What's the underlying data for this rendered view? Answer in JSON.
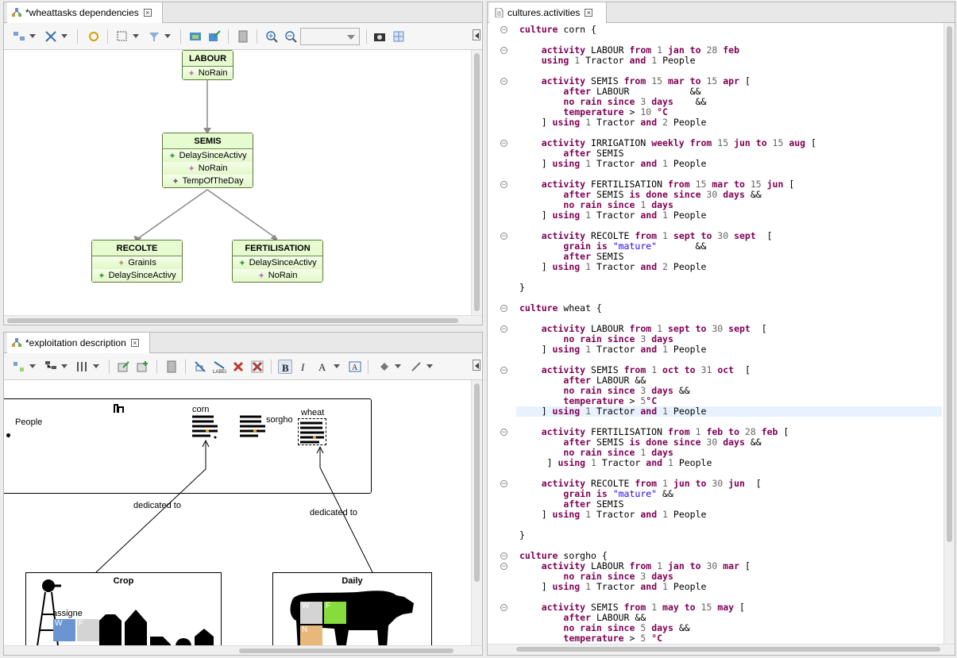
{
  "left_top": {
    "tab_title": "*wheattasks dependencies",
    "nodes": [
      {
        "title": "LABOUR",
        "rows": [
          {
            "icon": "pink-star-icon",
            "label": "NoRain"
          }
        ]
      },
      {
        "title": "SEMIS",
        "rows": [
          {
            "icon": "green-star-icon",
            "label": "DelaySinceActivy"
          },
          {
            "icon": "pink-star-icon",
            "label": "NoRain"
          },
          {
            "icon": "gray-star-icon",
            "label": "TempOfTheDay"
          }
        ]
      },
      {
        "title": "RECOLTE",
        "rows": [
          {
            "icon": "tan-star-icon",
            "label": "GrainIs"
          },
          {
            "icon": "green-star-icon",
            "label": "DelaySinceActivy"
          }
        ]
      },
      {
        "title": "FERTILISATION",
        "rows": [
          {
            "icon": "green-star-icon",
            "label": "DelaySinceActivy"
          },
          {
            "icon": "pink-star-icon",
            "label": "NoRain"
          }
        ]
      }
    ]
  },
  "left_bottom": {
    "tab_title": "*exploitation description",
    "labels": {
      "people": "People",
      "corn": "corn",
      "sorgho": "sorgho",
      "wheat": "wheat",
      "dedicated1": "dedicated to",
      "dedicated2": "dedicated to",
      "crop": "Crop",
      "daily": "Daily",
      "assigned": "assigne",
      "w1": "W",
      "f1": "F",
      "w2": "W",
      "f2": "F",
      "n2": "N"
    }
  },
  "right": {
    "tab_title": "cultures.activities",
    "highlight_line": 37,
    "lines": [
      [
        {
          "t": "culture ",
          "c": "kw"
        },
        {
          "t": "corn {",
          "c": "nm"
        }
      ],
      [],
      [
        {
          "t": "    "
        },
        {
          "t": "activity ",
          "c": "kw"
        },
        {
          "t": "LABOUR ",
          "c": "nm"
        },
        {
          "t": "from ",
          "c": "kw"
        },
        {
          "t": "1 ",
          "c": "num"
        },
        {
          "t": "jan ",
          "c": "kw"
        },
        {
          "t": "to ",
          "c": "kw"
        },
        {
          "t": "28 ",
          "c": "num"
        },
        {
          "t": "feb",
          "c": "kw"
        }
      ],
      [
        {
          "t": "    "
        },
        {
          "t": "using ",
          "c": "kw"
        },
        {
          "t": "1 ",
          "c": "num"
        },
        {
          "t": "Tractor ",
          "c": "nm"
        },
        {
          "t": "and ",
          "c": "kw"
        },
        {
          "t": "1 ",
          "c": "num"
        },
        {
          "t": "People",
          "c": "nm"
        }
      ],
      [],
      [
        {
          "t": "    "
        },
        {
          "t": "activity ",
          "c": "kw"
        },
        {
          "t": "SEMIS ",
          "c": "nm"
        },
        {
          "t": "from ",
          "c": "kw"
        },
        {
          "t": "15 ",
          "c": "num"
        },
        {
          "t": "mar ",
          "c": "kw"
        },
        {
          "t": "to ",
          "c": "kw"
        },
        {
          "t": "15 ",
          "c": "num"
        },
        {
          "t": "apr ",
          "c": "kw"
        },
        {
          "t": "[",
          "c": "nm"
        }
      ],
      [
        {
          "t": "        "
        },
        {
          "t": "after ",
          "c": "kw"
        },
        {
          "t": "LABOUR           &&",
          "c": "nm"
        }
      ],
      [
        {
          "t": "        "
        },
        {
          "t": "no rain since ",
          "c": "kw"
        },
        {
          "t": "3 ",
          "c": "num"
        },
        {
          "t": "days",
          "c": "kw"
        },
        {
          "t": "    &&",
          "c": "nm"
        }
      ],
      [
        {
          "t": "        "
        },
        {
          "t": "temperature ",
          "c": "kw"
        },
        {
          "t": "> ",
          "c": "nm"
        },
        {
          "t": "10 ",
          "c": "num"
        },
        {
          "t": "°C",
          "c": "kw"
        }
      ],
      [
        {
          "t": "    ] "
        },
        {
          "t": "using ",
          "c": "kw"
        },
        {
          "t": "1 ",
          "c": "num"
        },
        {
          "t": "Tractor ",
          "c": "nm"
        },
        {
          "t": "and ",
          "c": "kw"
        },
        {
          "t": "2 ",
          "c": "num"
        },
        {
          "t": "People",
          "c": "nm"
        }
      ],
      [],
      [
        {
          "t": "    "
        },
        {
          "t": "activity ",
          "c": "kw"
        },
        {
          "t": "IRRIGATION ",
          "c": "nm"
        },
        {
          "t": "weekly ",
          "c": "kw"
        },
        {
          "t": "from ",
          "c": "kw"
        },
        {
          "t": "15 ",
          "c": "num"
        },
        {
          "t": "jun ",
          "c": "kw"
        },
        {
          "t": "to ",
          "c": "kw"
        },
        {
          "t": "15 ",
          "c": "num"
        },
        {
          "t": "aug ",
          "c": "kw"
        },
        {
          "t": "[",
          "c": "nm"
        }
      ],
      [
        {
          "t": "        "
        },
        {
          "t": "after ",
          "c": "kw"
        },
        {
          "t": "SEMIS",
          "c": "nm"
        }
      ],
      [
        {
          "t": "    ] "
        },
        {
          "t": "using ",
          "c": "kw"
        },
        {
          "t": "1 ",
          "c": "num"
        },
        {
          "t": "Tractor ",
          "c": "nm"
        },
        {
          "t": "and ",
          "c": "kw"
        },
        {
          "t": "1 ",
          "c": "num"
        },
        {
          "t": "People",
          "c": "nm"
        }
      ],
      [],
      [
        {
          "t": "    "
        },
        {
          "t": "activity ",
          "c": "kw"
        },
        {
          "t": "FERTILISATION ",
          "c": "nm"
        },
        {
          "t": "from ",
          "c": "kw"
        },
        {
          "t": "15 ",
          "c": "num"
        },
        {
          "t": "mar ",
          "c": "kw"
        },
        {
          "t": "to ",
          "c": "kw"
        },
        {
          "t": "15 ",
          "c": "num"
        },
        {
          "t": "jun ",
          "c": "kw"
        },
        {
          "t": "[",
          "c": "nm"
        }
      ],
      [
        {
          "t": "        "
        },
        {
          "t": "after ",
          "c": "kw"
        },
        {
          "t": "SEMIS ",
          "c": "nm"
        },
        {
          "t": "is done since ",
          "c": "kw"
        },
        {
          "t": "30 ",
          "c": "num"
        },
        {
          "t": "days ",
          "c": "kw"
        },
        {
          "t": "&&",
          "c": "nm"
        }
      ],
      [
        {
          "t": "        "
        },
        {
          "t": "no rain since ",
          "c": "kw"
        },
        {
          "t": "1 ",
          "c": "num"
        },
        {
          "t": "days",
          "c": "kw"
        }
      ],
      [
        {
          "t": "    ] "
        },
        {
          "t": "using ",
          "c": "kw"
        },
        {
          "t": "1 ",
          "c": "num"
        },
        {
          "t": "Tractor ",
          "c": "nm"
        },
        {
          "t": "and ",
          "c": "kw"
        },
        {
          "t": "1 ",
          "c": "num"
        },
        {
          "t": "People",
          "c": "nm"
        }
      ],
      [],
      [
        {
          "t": "    "
        },
        {
          "t": "activity ",
          "c": "kw"
        },
        {
          "t": "RECOLTE ",
          "c": "nm"
        },
        {
          "t": "from ",
          "c": "kw"
        },
        {
          "t": "1 ",
          "c": "num"
        },
        {
          "t": "sept ",
          "c": "kw"
        },
        {
          "t": "to ",
          "c": "kw"
        },
        {
          "t": "30 ",
          "c": "num"
        },
        {
          "t": "sept  ",
          "c": "kw"
        },
        {
          "t": "[",
          "c": "nm"
        }
      ],
      [
        {
          "t": "        "
        },
        {
          "t": "grain is ",
          "c": "kw"
        },
        {
          "t": "\"mature\"",
          "c": "str"
        },
        {
          "t": "       &&",
          "c": "nm"
        }
      ],
      [
        {
          "t": "        "
        },
        {
          "t": "after ",
          "c": "kw"
        },
        {
          "t": "SEMIS",
          "c": "nm"
        }
      ],
      [
        {
          "t": "    ] "
        },
        {
          "t": "using ",
          "c": "kw"
        },
        {
          "t": "1 ",
          "c": "num"
        },
        {
          "t": "Tractor ",
          "c": "nm"
        },
        {
          "t": "and ",
          "c": "kw"
        },
        {
          "t": "2 ",
          "c": "num"
        },
        {
          "t": "People",
          "c": "nm"
        }
      ],
      [],
      [
        {
          "t": "}",
          "c": "nm"
        }
      ],
      [],
      [
        {
          "t": "culture ",
          "c": "kw"
        },
        {
          "t": "wheat {",
          "c": "nm"
        }
      ],
      [],
      [
        {
          "t": "    "
        },
        {
          "t": "activity ",
          "c": "kw"
        },
        {
          "t": "LABOUR ",
          "c": "nm"
        },
        {
          "t": "from ",
          "c": "kw"
        },
        {
          "t": "1 ",
          "c": "num"
        },
        {
          "t": "sept ",
          "c": "kw"
        },
        {
          "t": "to ",
          "c": "kw"
        },
        {
          "t": "30 ",
          "c": "num"
        },
        {
          "t": "sept  ",
          "c": "kw"
        },
        {
          "t": "[",
          "c": "nm"
        }
      ],
      [
        {
          "t": "        "
        },
        {
          "t": "no rain since ",
          "c": "kw"
        },
        {
          "t": "3 ",
          "c": "num"
        },
        {
          "t": "days",
          "c": "kw"
        }
      ],
      [
        {
          "t": "    ] "
        },
        {
          "t": "using ",
          "c": "kw"
        },
        {
          "t": "1 ",
          "c": "num"
        },
        {
          "t": "Tractor ",
          "c": "nm"
        },
        {
          "t": "and ",
          "c": "kw"
        },
        {
          "t": "1 ",
          "c": "num"
        },
        {
          "t": "People",
          "c": "nm"
        }
      ],
      [],
      [
        {
          "t": "    "
        },
        {
          "t": "activity ",
          "c": "kw"
        },
        {
          "t": "SEMIS ",
          "c": "nm"
        },
        {
          "t": "from ",
          "c": "kw"
        },
        {
          "t": "1 ",
          "c": "num"
        },
        {
          "t": "oct ",
          "c": "kw"
        },
        {
          "t": "to ",
          "c": "kw"
        },
        {
          "t": "31 ",
          "c": "num"
        },
        {
          "t": "oct  ",
          "c": "kw"
        },
        {
          "t": "[",
          "c": "nm"
        }
      ],
      [
        {
          "t": "        "
        },
        {
          "t": "after ",
          "c": "kw"
        },
        {
          "t": "LABOUR &&",
          "c": "nm"
        }
      ],
      [
        {
          "t": "        "
        },
        {
          "t": "no rain since ",
          "c": "kw"
        },
        {
          "t": "3 ",
          "c": "num"
        },
        {
          "t": "days ",
          "c": "kw"
        },
        {
          "t": "&&",
          "c": "nm"
        }
      ],
      [
        {
          "t": "        "
        },
        {
          "t": "temperature ",
          "c": "kw"
        },
        {
          "t": "> ",
          "c": "nm"
        },
        {
          "t": "5",
          "c": "num"
        },
        {
          "t": "°C",
          "c": "kw"
        }
      ],
      [
        {
          "t": "    ] "
        },
        {
          "t": "using ",
          "c": "kw"
        },
        {
          "t": "1 ",
          "c": "num"
        },
        {
          "t": "Tractor ",
          "c": "nm"
        },
        {
          "t": "and ",
          "c": "kw"
        },
        {
          "t": "1 ",
          "c": "num"
        },
        {
          "t": "People",
          "c": "nm"
        }
      ],
      [],
      [
        {
          "t": "    "
        },
        {
          "t": "activity ",
          "c": "kw"
        },
        {
          "t": "FERTILISATION ",
          "c": "nm"
        },
        {
          "t": "from ",
          "c": "kw"
        },
        {
          "t": "1 ",
          "c": "num"
        },
        {
          "t": "feb ",
          "c": "kw"
        },
        {
          "t": "to ",
          "c": "kw"
        },
        {
          "t": "28 ",
          "c": "num"
        },
        {
          "t": "feb ",
          "c": "kw"
        },
        {
          "t": "[",
          "c": "nm"
        }
      ],
      [
        {
          "t": "        "
        },
        {
          "t": "after ",
          "c": "kw"
        },
        {
          "t": "SEMIS ",
          "c": "nm"
        },
        {
          "t": "is done since ",
          "c": "kw"
        },
        {
          "t": "30 ",
          "c": "num"
        },
        {
          "t": "days ",
          "c": "kw"
        },
        {
          "t": "&&",
          "c": "nm"
        }
      ],
      [
        {
          "t": "        "
        },
        {
          "t": "no rain since ",
          "c": "kw"
        },
        {
          "t": "1 ",
          "c": "num"
        },
        {
          "t": "days",
          "c": "kw"
        }
      ],
      [
        {
          "t": "     ] "
        },
        {
          "t": "using ",
          "c": "kw"
        },
        {
          "t": "1 ",
          "c": "num"
        },
        {
          "t": "Tractor ",
          "c": "nm"
        },
        {
          "t": "and ",
          "c": "kw"
        },
        {
          "t": "1 ",
          "c": "num"
        },
        {
          "t": "People",
          "c": "nm"
        }
      ],
      [],
      [
        {
          "t": "    "
        },
        {
          "t": "activity ",
          "c": "kw"
        },
        {
          "t": "RECOLTE ",
          "c": "nm"
        },
        {
          "t": "from ",
          "c": "kw"
        },
        {
          "t": "1 ",
          "c": "num"
        },
        {
          "t": "jun ",
          "c": "kw"
        },
        {
          "t": "to ",
          "c": "kw"
        },
        {
          "t": "30 ",
          "c": "num"
        },
        {
          "t": "jun  ",
          "c": "kw"
        },
        {
          "t": "[",
          "c": "nm"
        }
      ],
      [
        {
          "t": "        "
        },
        {
          "t": "grain is ",
          "c": "kw"
        },
        {
          "t": "\"mature\"",
          "c": "str"
        },
        {
          "t": " &&",
          "c": "nm"
        }
      ],
      [
        {
          "t": "        "
        },
        {
          "t": "after ",
          "c": "kw"
        },
        {
          "t": "SEMIS",
          "c": "nm"
        }
      ],
      [
        {
          "t": "    ] "
        },
        {
          "t": "using ",
          "c": "kw"
        },
        {
          "t": "1 ",
          "c": "num"
        },
        {
          "t": "Tractor ",
          "c": "nm"
        },
        {
          "t": "and ",
          "c": "kw"
        },
        {
          "t": "1 ",
          "c": "num"
        },
        {
          "t": "People",
          "c": "nm"
        }
      ],
      [],
      [
        {
          "t": "}",
          "c": "nm"
        }
      ],
      [],
      [
        {
          "t": "culture ",
          "c": "kw"
        },
        {
          "t": "sorgho {",
          "c": "nm"
        }
      ],
      [
        {
          "t": "    "
        },
        {
          "t": "activity ",
          "c": "kw"
        },
        {
          "t": "LABOUR ",
          "c": "nm"
        },
        {
          "t": "from ",
          "c": "kw"
        },
        {
          "t": "1 ",
          "c": "num"
        },
        {
          "t": "jan ",
          "c": "kw"
        },
        {
          "t": "to ",
          "c": "kw"
        },
        {
          "t": "30 ",
          "c": "num"
        },
        {
          "t": "mar ",
          "c": "kw"
        },
        {
          "t": "[",
          "c": "nm"
        }
      ],
      [
        {
          "t": "        "
        },
        {
          "t": "no rain since ",
          "c": "kw"
        },
        {
          "t": "3 ",
          "c": "num"
        },
        {
          "t": "days",
          "c": "kw"
        }
      ],
      [
        {
          "t": "    ] "
        },
        {
          "t": "using ",
          "c": "kw"
        },
        {
          "t": "1 ",
          "c": "num"
        },
        {
          "t": "Tractor ",
          "c": "nm"
        },
        {
          "t": "and ",
          "c": "kw"
        },
        {
          "t": "1 ",
          "c": "num"
        },
        {
          "t": "People",
          "c": "nm"
        }
      ],
      [],
      [
        {
          "t": "    "
        },
        {
          "t": "activity ",
          "c": "kw"
        },
        {
          "t": "SEMIS ",
          "c": "nm"
        },
        {
          "t": "from ",
          "c": "kw"
        },
        {
          "t": "1 ",
          "c": "num"
        },
        {
          "t": "may ",
          "c": "kw"
        },
        {
          "t": "to ",
          "c": "kw"
        },
        {
          "t": "15 ",
          "c": "num"
        },
        {
          "t": "may ",
          "c": "kw"
        },
        {
          "t": "[",
          "c": "nm"
        }
      ],
      [
        {
          "t": "        "
        },
        {
          "t": "after ",
          "c": "kw"
        },
        {
          "t": "LABOUR &&",
          "c": "nm"
        }
      ],
      [
        {
          "t": "        "
        },
        {
          "t": "no rain since ",
          "c": "kw"
        },
        {
          "t": "5 ",
          "c": "num"
        },
        {
          "t": "days ",
          "c": "kw"
        },
        {
          "t": "&&",
          "c": "nm"
        }
      ],
      [
        {
          "t": "        "
        },
        {
          "t": "temperature ",
          "c": "kw"
        },
        {
          "t": "> ",
          "c": "nm"
        },
        {
          "t": "5 ",
          "c": "num"
        },
        {
          "t": "°C",
          "c": "kw"
        }
      ]
    ]
  }
}
